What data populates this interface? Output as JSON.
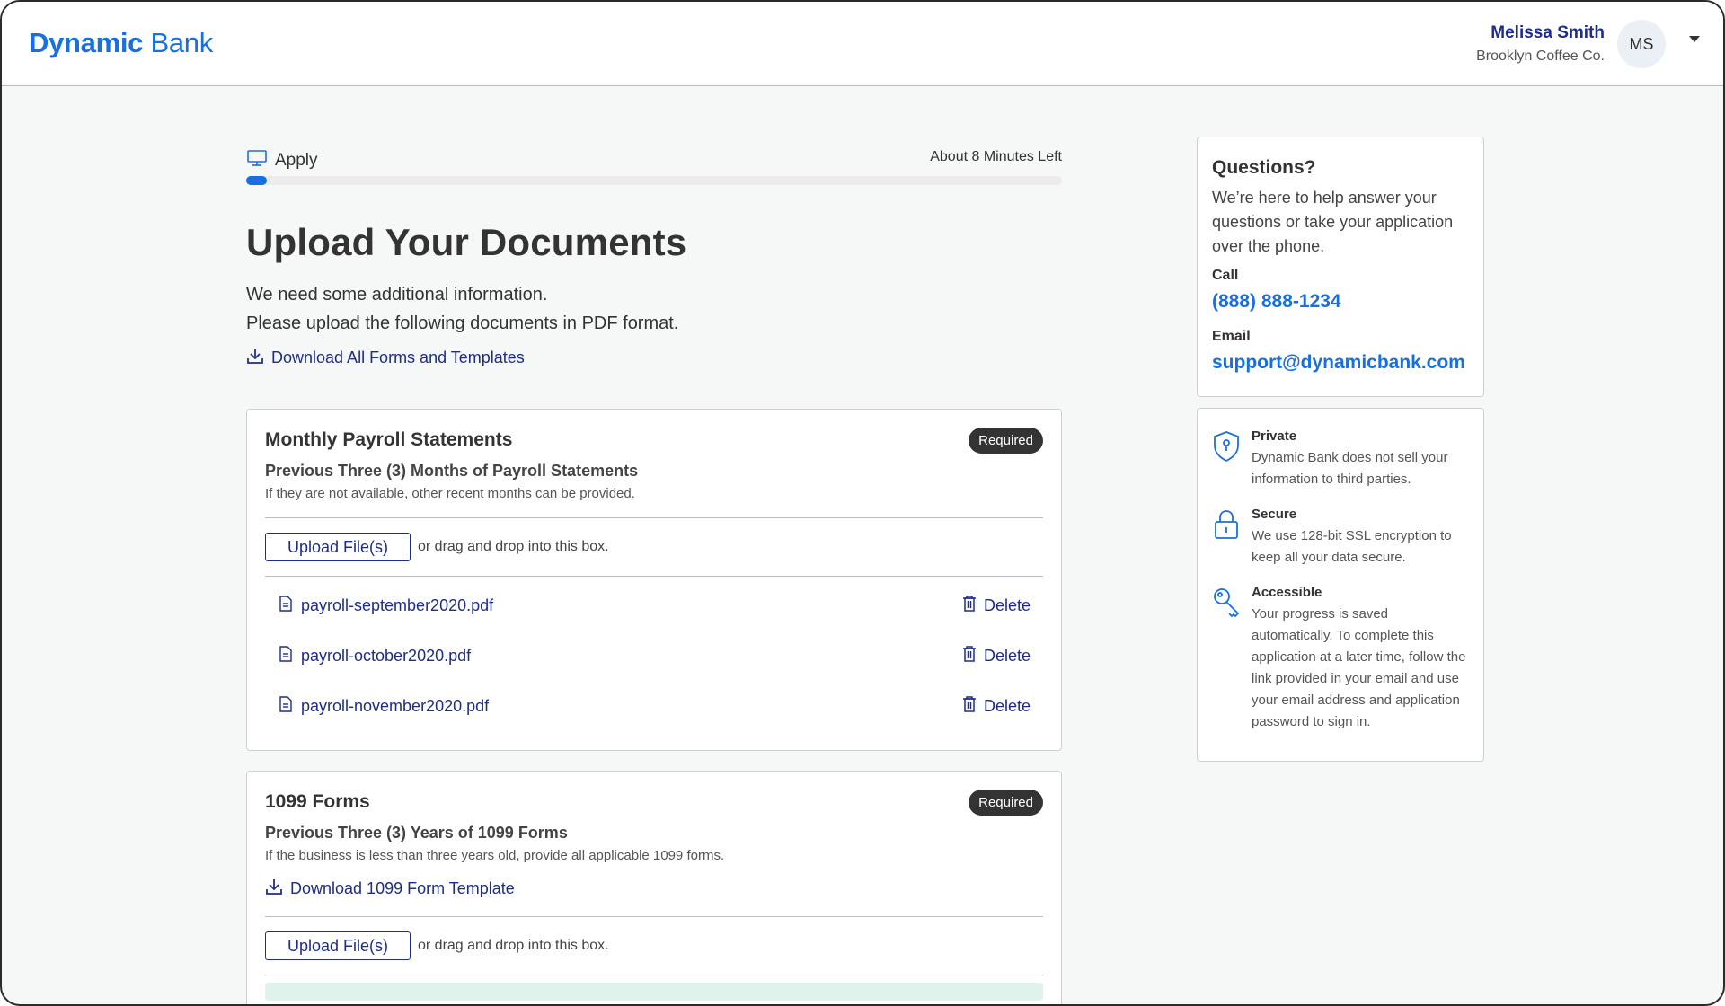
{
  "header": {
    "logo_primary": "Dynamic",
    "logo_secondary": "Bank",
    "user_name": "Melissa Smith",
    "user_company": "Brooklyn Coffee Co.",
    "avatar_initials": "MS"
  },
  "progress": {
    "step_label": "Apply",
    "time_left": "About 8 Minutes Left",
    "fraction_complete": 0.025
  },
  "page": {
    "title": "Upload Your Documents",
    "intro_line1": "We need some additional information.",
    "intro_line2": "Please upload the following documents in PDF format.",
    "download_all_label": "Download All Forms and Templates"
  },
  "cards": [
    {
      "title": "Monthly Payroll Statements",
      "badge": "Required",
      "subtitle": "Previous Three (3) Months of Payroll Statements",
      "note": "If they are not available, other recent months can be provided.",
      "upload_label": "Upload File(s)",
      "upload_hint": "or drag and drop into this box.",
      "files": [
        {
          "name": "payroll-september2020.pdf",
          "action": "Delete"
        },
        {
          "name": "payroll-october2020.pdf",
          "action": "Delete"
        },
        {
          "name": "payroll-november2020.pdf",
          "action": "Delete"
        }
      ]
    },
    {
      "title": "1099 Forms",
      "badge": "Required",
      "subtitle": "Previous Three (3) Years of 1099 Forms",
      "note": "If the business is less than three years old, provide all applicable 1099 forms.",
      "template_link": "Download 1099 Form Template",
      "upload_label": "Upload File(s)",
      "upload_hint": "or drag and drop into this box."
    }
  ],
  "questions": {
    "title": "Questions?",
    "text": "We’re here to help answer your questions or take your application over the phone.",
    "call_label": "Call",
    "phone": "(888) 888-1234",
    "email_label": "Email",
    "email": "support@dynamicbank.com"
  },
  "info": [
    {
      "title": "Private",
      "text": "Dynamic Bank does not sell your information to third parties.",
      "icon": "shield-icon"
    },
    {
      "title": "Secure",
      "text": "We use 128-bit SSL encryption to keep all your data secure.",
      "icon": "lock-icon"
    },
    {
      "title": "Accessible",
      "text": "Your progress is saved automatically. To complete this application at a later time, follow the link provided in your email and use your email address and application password to sign in.",
      "icon": "key-icon"
    }
  ],
  "colors": {
    "brand_blue": "#1a6fe0",
    "link_navy": "#1f2d8a",
    "badge_dark": "#333333",
    "success_strip": "#dff2ec"
  }
}
